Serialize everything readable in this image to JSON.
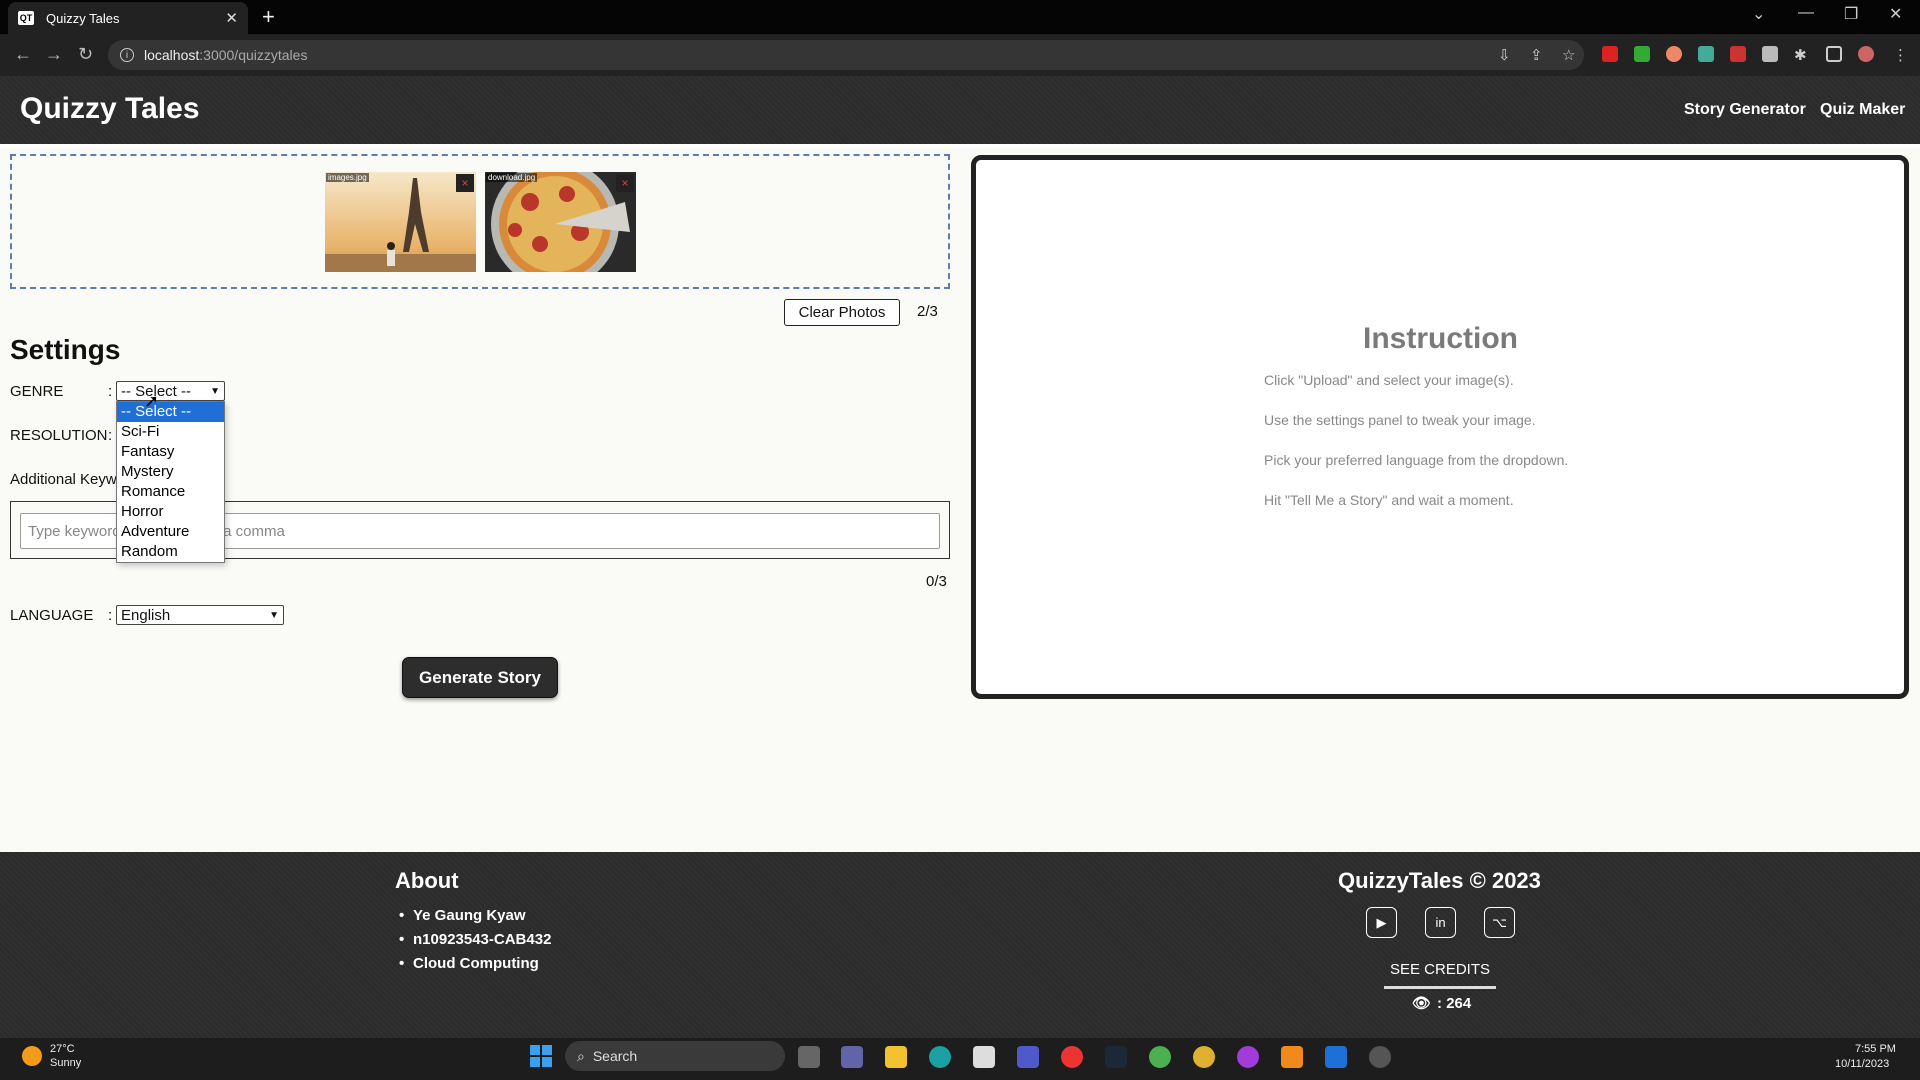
{
  "browser": {
    "tab_title": "Quizzy Tales",
    "url_host": "localhost",
    "url_path": ":3000/quizzytales"
  },
  "header": {
    "brand": "Quizzy Tales",
    "nav": [
      "Story Generator",
      "Quiz Maker"
    ]
  },
  "upload": {
    "photos": [
      {
        "name": "images.jpg",
        "remove": "×"
      },
      {
        "name": "download.jpg",
        "remove": "×"
      }
    ],
    "clear_label": "Clear Photos",
    "count": "2/3"
  },
  "settings": {
    "title": "Settings",
    "genre_label": "GENRE",
    "resolution_label": "RESOLUTION",
    "keywords_label": "Additional Keywords",
    "colon": ":",
    "genre_selected": "-- Select --",
    "genre_options": [
      "-- Select --",
      "Sci-Fi",
      "Fantasy",
      "Mystery",
      "Romance",
      "Horror",
      "Adventure",
      "Random"
    ],
    "keyword_placeholder": "Type keywords separated by a comma",
    "keyword_count": "0/3",
    "language_label": "LANGUAGE",
    "language_selected": "English",
    "generate_label": "Generate Story"
  },
  "instruction": {
    "title": "Instruction",
    "lines": [
      "Click \"Upload\" and select your image(s).",
      "Use the settings panel to tweak your image.",
      "Pick your preferred language from the dropdown.",
      "Hit \"Tell Me a Story\" and wait a moment."
    ]
  },
  "footer": {
    "about_title": "About",
    "about_items": [
      "Ye Gaung Kyaw",
      "n10923543-CAB432",
      "Cloud Computing"
    ],
    "copyright": "QuizzyTales © 2023",
    "see_credits": "SEE CREDITS",
    "views": ": 264"
  },
  "taskbar": {
    "weather_temp": "27°C",
    "weather_desc": "Sunny",
    "search": "Search",
    "time": "7:55 PM",
    "date": "10/11/2023"
  }
}
